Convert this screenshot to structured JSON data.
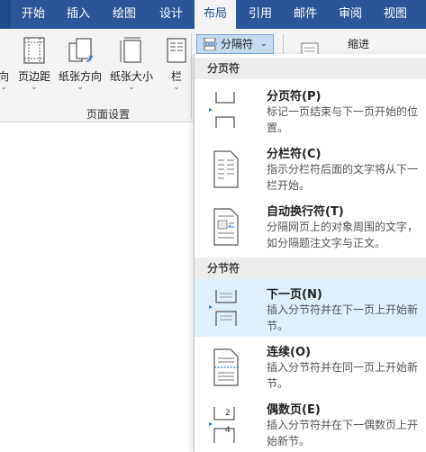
{
  "tabs": [
    {
      "label": "开始",
      "active": false
    },
    {
      "label": "插入",
      "active": false
    },
    {
      "label": "绘图",
      "active": false
    },
    {
      "label": "设计",
      "active": false
    },
    {
      "label": "布局",
      "active": true
    },
    {
      "label": "引用",
      "active": false
    },
    {
      "label": "邮件",
      "active": false
    },
    {
      "label": "审阅",
      "active": false
    },
    {
      "label": "视图",
      "active": false
    }
  ],
  "ribbon": {
    "buttons": [
      {
        "label": "向",
        "icon": "text-direction-icon"
      },
      {
        "label": "页边距",
        "icon": "margins-icon"
      },
      {
        "label": "纸张方向",
        "icon": "orientation-icon"
      },
      {
        "label": "纸张大小",
        "icon": "size-icon"
      },
      {
        "label": "栏",
        "icon": "columns-icon"
      }
    ],
    "chevron": "⌄",
    "group_label": "页面设置",
    "breaks_button": {
      "label": "分隔符",
      "chevron": "⌄",
      "icon": "breaks-icon"
    },
    "indent_label": "缩进"
  },
  "menu": {
    "sections": [
      {
        "label": "分页符"
      },
      {
        "label": "分节符"
      }
    ],
    "items": [
      {
        "title": "分页符(P)",
        "desc": "标记一页结束与下一页开始的位置。",
        "icon": "page-break-icon",
        "highlighted": false
      },
      {
        "title": "分栏符(C)",
        "desc": "指示分栏符后面的文字将从下一栏开始。",
        "icon": "column-break-icon",
        "highlighted": false
      },
      {
        "title": "自动换行符(T)",
        "desc": "分隔网页上的对象周围的文字，如分隔题注文字与正文。",
        "icon": "text-wrapping-icon",
        "highlighted": false
      },
      {
        "title": "下一页(N)",
        "desc": "插入分节符并在下一页上开始新节。",
        "icon": "next-page-icon",
        "highlighted": true
      },
      {
        "title": "连续(O)",
        "desc": "插入分节符并在同一页上开始新节。",
        "icon": "continuous-icon",
        "highlighted": false
      },
      {
        "title": "偶数页(E)",
        "desc": "插入分节符并在下一偶数页上开始新节。",
        "icon": "even-page-icon",
        "highlighted": false
      }
    ],
    "even_page_numbers": [
      "2",
      "4"
    ]
  },
  "colors": {
    "tab_bar": "#2b579a",
    "ribbon": "#f3f3f3",
    "highlight": "#dff0fb",
    "accent_icon": "#2b7bd0"
  }
}
